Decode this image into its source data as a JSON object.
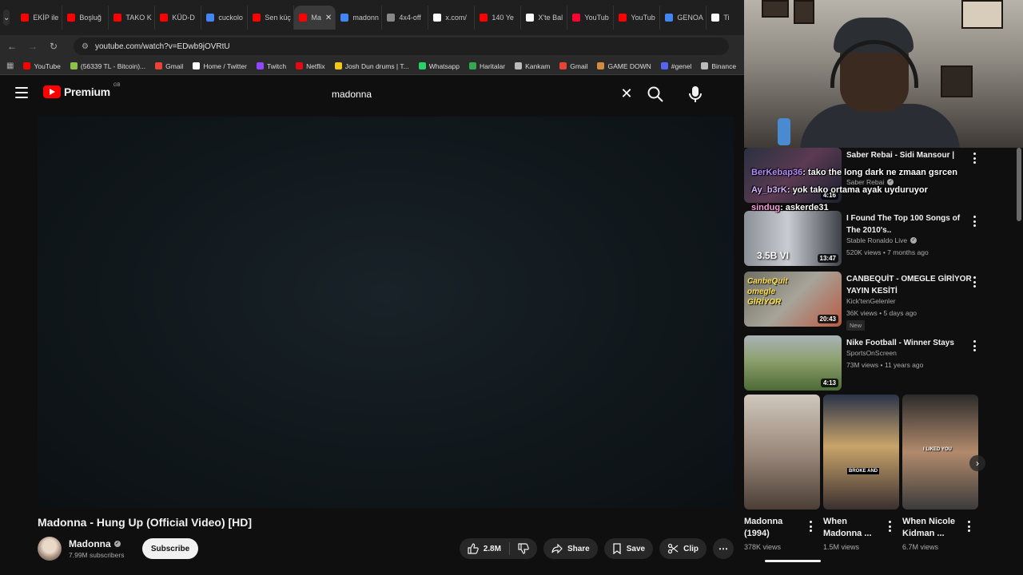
{
  "browser": {
    "tabs": [
      {
        "label": "EKİP ile",
        "color": "#ff0000"
      },
      {
        "label": "Boşluğ",
        "color": "#ff0000"
      },
      {
        "label": "TAKO K",
        "color": "#ff0000"
      },
      {
        "label": "KÜD-D",
        "color": "#ff0000"
      },
      {
        "label": "cuckolo",
        "color": "#4285f4"
      },
      {
        "label": "Sen küç",
        "color": "#ff0000"
      },
      {
        "label": "Ma",
        "color": "#ff0000",
        "active": true
      },
      {
        "label": "madonn",
        "color": "#4285f4"
      },
      {
        "label": "4x4-off",
        "color": "#888888"
      },
      {
        "label": "x.com/",
        "color": "#ffffff"
      },
      {
        "label": "140 Ye",
        "color": "#ff0000"
      },
      {
        "label": "X'te Bal",
        "color": "#ffffff"
      },
      {
        "label": "YouTub",
        "color": "#ff0033"
      },
      {
        "label": "YouTub",
        "color": "#ff0000"
      },
      {
        "label": "GENOA",
        "color": "#4285f4"
      },
      {
        "label": "Ti",
        "color": "#ffffff"
      }
    ],
    "url": "youtube.com/watch?v=EDwb9jOVRtU",
    "bookmarks": [
      {
        "label": "YouTube",
        "color": "#ff0000"
      },
      {
        "label": "(56339 TL - Bitcoin)...",
        "color": "#8bc34a"
      },
      {
        "label": "Gmail",
        "color": "#ea4335"
      },
      {
        "label": "Home / Twitter",
        "color": "#ffffff"
      },
      {
        "label": "Twitch",
        "color": "#9146ff"
      },
      {
        "label": "Netflix",
        "color": "#e50914"
      },
      {
        "label": "Josh Dun drums | T...",
        "color": "#f5c518"
      },
      {
        "label": "Whatsapp",
        "color": "#25d366"
      },
      {
        "label": "Haritalar",
        "color": "#34a853"
      },
      {
        "label": "Kankam",
        "color": "#bbbbbb"
      },
      {
        "label": "Gmail",
        "color": "#ea4335"
      },
      {
        "label": "GAME DOWN",
        "color": "#d38b3f"
      },
      {
        "label": "#genel",
        "color": "#5865f2"
      },
      {
        "label": "Binance",
        "color": "#bbbbbb"
      }
    ]
  },
  "youtube": {
    "logo_text": "Premium",
    "logo_region": "GB",
    "search_value": "madonna",
    "video": {
      "title": "Madonna - Hung Up (Official Video) [HD]",
      "channel": "Madonna",
      "subscribers": "7.99M subscribers",
      "subscribe_label": "Subscribe",
      "likes": "2.8M",
      "share_label": "Share",
      "save_label": "Save",
      "clip_label": "Clip"
    },
    "related": [
      {
        "title": "Saber Rebai - Sidi Mansour |",
        "channel": "Saber Rebai",
        "meta": "",
        "duration": "4:16"
      },
      {
        "title": "I Found The Top 100 Songs of The 2010's..",
        "channel": "Stable Ronaldo Live",
        "meta": "520K views • 7 months ago",
        "duration": "13:47",
        "thumb_text": "3.5B VI"
      },
      {
        "title": "CANBEQUİT - OMEGLE GİRİYOR YAYIN KESİTİ",
        "channel": "Kick'tenGelenler",
        "meta": "36K views • 5 days ago",
        "duration": "20:43",
        "badge": "New",
        "thumb_text": "CanbeQuit omegle GİRİYOR"
      },
      {
        "title": "Nike Football - Winner Stays",
        "channel": "SportsOnScreen",
        "meta": "73M views • 11 years ago",
        "duration": "4:13"
      }
    ],
    "shorts": [
      {
        "title": "Madonna (1994)",
        "views": "378K views"
      },
      {
        "title": "When Madonna ...",
        "views": "1.5M views",
        "overlay": "BROKE AND"
      },
      {
        "title": "When Nicole Kidman ...",
        "views": "6.7M views",
        "overlay": "I LIKED YOU"
      }
    ]
  },
  "stream_chat": [
    {
      "user": "BerKebap36",
      "msg": ": tako the long dark ne zmaan gsrcen"
    },
    {
      "user": "Ay_b3rK",
      "msg": ": yok tako ortama ayak uyduruyor"
    },
    {
      "user": "sindug",
      "msg": ": askerde31"
    }
  ]
}
